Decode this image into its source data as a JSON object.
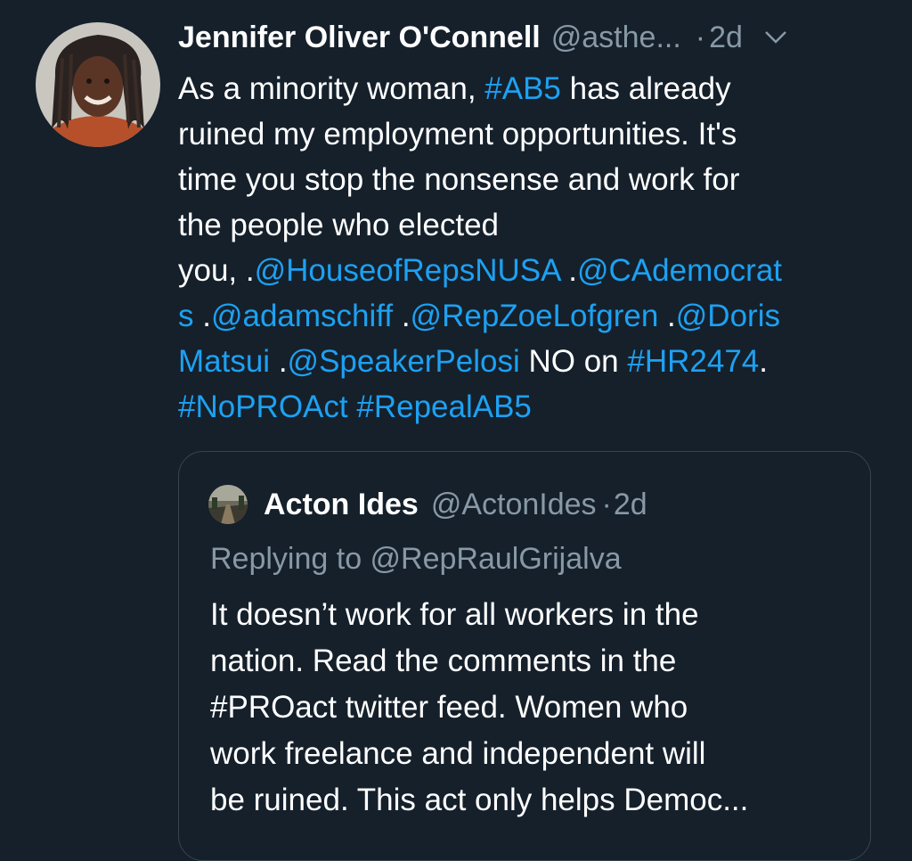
{
  "tweet": {
    "author_name": "Jennifer Oliver O'Connell",
    "author_handle": "@asthe...",
    "dot": "·",
    "time": "2d",
    "avatar_icon": "profile-photo",
    "menu_icon": "chevron-down-icon",
    "text_lines": [
      [
        {
          "t": "As a minority woman, ",
          "link": false
        },
        {
          "t": "#AB5",
          "link": true
        },
        {
          "t": " has already",
          "link": false
        }
      ],
      [
        {
          "t": "ruined my employment opportunities. It's",
          "link": false
        }
      ],
      [
        {
          "t": "time you stop the nonsense and work for",
          "link": false
        }
      ],
      [
        {
          "t": "the people who elected",
          "link": false
        }
      ],
      [
        {
          "t": "you, .",
          "link": false
        },
        {
          "t": "@HouseofRepsNUSA",
          "link": true
        },
        {
          "t": " .",
          "link": false
        },
        {
          "t": "@CAdemocrat",
          "link": true
        }
      ],
      [
        {
          "t": "s",
          "link": true
        },
        {
          "t": " .",
          "link": false
        },
        {
          "t": "@adamschiff",
          "link": true
        },
        {
          "t": " .",
          "link": false
        },
        {
          "t": "@RepZoeLofgren",
          "link": true
        },
        {
          "t": " .",
          "link": false
        },
        {
          "t": "@Doris",
          "link": true
        }
      ],
      [
        {
          "t": "Matsui",
          "link": true
        },
        {
          "t": " .",
          "link": false
        },
        {
          "t": "@SpeakerPelosi",
          "link": true
        },
        {
          "t": " NO on ",
          "link": false
        },
        {
          "t": "#HR2474",
          "link": true
        },
        {
          "t": ".",
          "link": false
        }
      ],
      [
        {
          "t": "#NoPROAct",
          "link": true
        },
        {
          "t": " ",
          "link": false
        },
        {
          "t": "#RepealAB5",
          "link": true
        }
      ]
    ],
    "link_color": "#1da1f2"
  },
  "quote": {
    "author_name": "Acton Ides",
    "author_handle": "@ActonIdes",
    "dot": "·",
    "time": "2d",
    "replying_to": "Replying to @RepRaulGrijalva",
    "text_lines": [
      "It doesn’t work for all workers in the",
      "nation. Read the comments in the",
      "#PROact twitter feed. Women who",
      "work freelance and independent will",
      "be ruined. This act only helps Democ..."
    ]
  },
  "colors": {
    "background": "#15202b",
    "secondary_text": "#8899a6",
    "border": "#38444d"
  }
}
